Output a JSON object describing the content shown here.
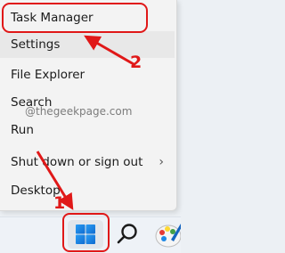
{
  "menu": {
    "items": [
      {
        "label": "Task Manager",
        "has_submenu": false
      },
      {
        "label": "Settings",
        "has_submenu": false
      },
      {
        "label": "File Explorer",
        "has_submenu": false
      },
      {
        "label": "Search",
        "has_submenu": false
      },
      {
        "label": "Run",
        "has_submenu": false
      },
      {
        "label": "Shut down or sign out",
        "has_submenu": true,
        "submenu_icon": "chevron-right-icon"
      },
      {
        "label": "Desktop",
        "has_submenu": false
      }
    ],
    "hovered_item": "Settings"
  },
  "watermark": "@thegeekpage.com",
  "annotations": {
    "step_1": "1",
    "step_2": "2",
    "highlight_color": "#e01818"
  },
  "taskbar": {
    "icons": [
      "windows-start-icon",
      "search-icon",
      "paint-icon"
    ]
  },
  "colors": {
    "start_blue": "#0f6cd0",
    "menu_bg": "#f3f3f3",
    "taskbar_bg": "#eef2f7"
  }
}
